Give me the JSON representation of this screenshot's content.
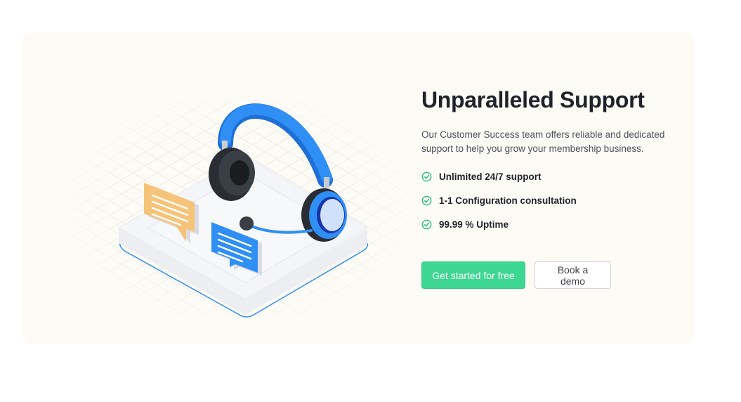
{
  "section": {
    "title": "Unparalleled Support",
    "description": "Our Customer Success team offers reliable and dedicated support to help you grow your membership business.",
    "features": [
      {
        "label": "Unlimited 24/7 support",
        "icon": "check-circle-icon"
      },
      {
        "label": "1-1 Configuration consultation",
        "icon": "check-circle-icon"
      },
      {
        "label": "99.99 % Uptime",
        "icon": "check-circle-icon"
      }
    ],
    "primary_button": "Get started for free",
    "secondary_button": "Book a demo"
  },
  "illustration": {
    "name": "headset-support-illustration"
  },
  "colors": {
    "card_background": "#fdfbf6",
    "accent_green": "#3dd692",
    "headset_blue": "#2f8ff5",
    "bubble_orange": "#f5c47a",
    "title_text": "#1f2329"
  }
}
